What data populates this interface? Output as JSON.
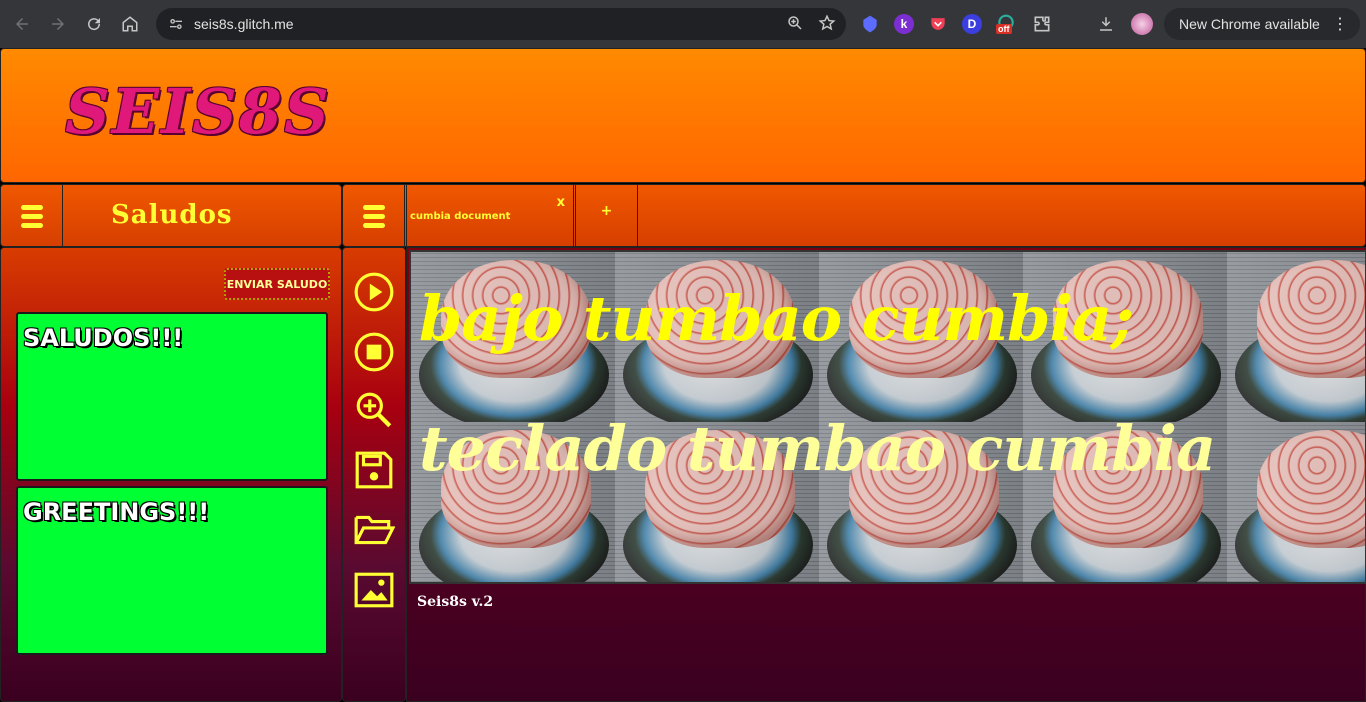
{
  "browser": {
    "url": "seis8s.glitch.me",
    "new_chrome_label": "New Chrome available",
    "extensions": [
      {
        "name": "shield-extension-icon",
        "text": ""
      },
      {
        "name": "k-extension-icon",
        "text": "k"
      },
      {
        "name": "pocket-extension-icon",
        "text": ""
      },
      {
        "name": "d-extension-icon",
        "text": "D"
      },
      {
        "name": "off-extension-icon",
        "text": "off"
      },
      {
        "name": "puzzle-extension-icon",
        "text": ""
      }
    ]
  },
  "header": {
    "logo": "SEIS8S"
  },
  "left_panel": {
    "title": "Saludos",
    "send_button": "ENVIAR SALUDO",
    "messages": [
      "SALUDOS!!!",
      "GREETINGS!!!"
    ]
  },
  "tabs": {
    "items": [
      {
        "label": "cumbia document",
        "close": "x"
      }
    ],
    "add_label": "+"
  },
  "editor": {
    "lines": [
      "bajo tumbao cumbia;",
      "teclado tumbao cumbia"
    ]
  },
  "footer": {
    "version": "Seis8s v.2"
  },
  "toolbar": {
    "tools": [
      "play-icon",
      "stop-icon",
      "zoom-in-icon",
      "save-icon",
      "folder-open-icon",
      "image-icon"
    ]
  },
  "colors": {
    "accent_yellow": "#ffff33",
    "header_orange": "#ff8a00",
    "card_green": "#00ff33",
    "logo_pink": "#e0187a"
  }
}
